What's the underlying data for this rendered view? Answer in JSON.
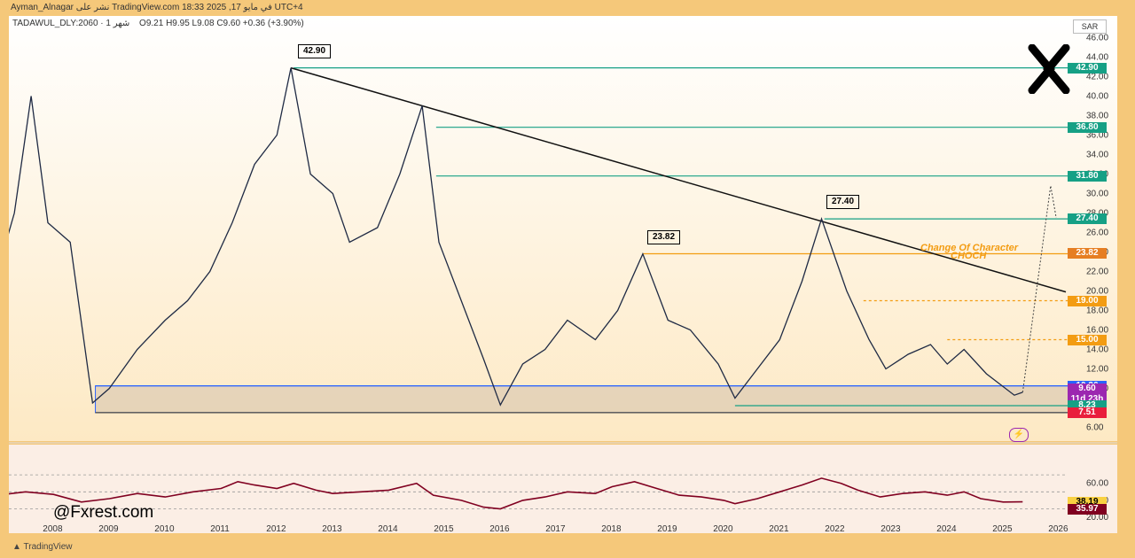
{
  "header": {
    "publisher": "Ayman_Alnagar نشر على TradingView.com في مايو 17, 2025 18:33 UTC+4",
    "symbol": "TADAWUL_DLY:2060 · 1 شهر",
    "ohlc": "O9.21  H9.95  L9.08  C9.60  +0.36 (+3.90%)",
    "currency": "SAR",
    "footer": "TradingView",
    "watermark": "@Fxrest.com"
  },
  "price_labels": [
    {
      "text": "42.90",
      "color": "#16a085"
    },
    {
      "text": "36.80",
      "color": "#16a085"
    },
    {
      "text": "31.80",
      "color": "#16a085"
    },
    {
      "text": "27.40",
      "color": "#16a085"
    },
    {
      "text": "23.82",
      "color": "#e67e22"
    },
    {
      "text": "19.00",
      "color": "#f39c12"
    },
    {
      "text": "15.00",
      "color": "#f39c12"
    },
    {
      "text": "10.26",
      "color": "#2962ff"
    },
    {
      "text": "9.60",
      "color": "#9c27b0"
    },
    {
      "text": "11d 23h",
      "color": "#9c27b0"
    },
    {
      "text": "8.23",
      "color": "#16a085"
    },
    {
      "text": "7.51",
      "color": "#e91e3c"
    }
  ],
  "peak_tags": [
    {
      "text": "42.90",
      "color": "#f23645"
    },
    {
      "text": "27.40",
      "color": "#00bcd4"
    },
    {
      "text": "23.82",
      "color": "#ff9800"
    }
  ],
  "annotations": {
    "choch_line1": "Change Of Character",
    "choch_line2": "CHOCH"
  },
  "rsi_labels": [
    {
      "text": "38.19",
      "color": "#f9d142"
    },
    {
      "text": "35.97",
      "color": "#800020"
    }
  ],
  "chart_data": [
    {
      "type": "line",
      "title": "",
      "ylim": [
        6,
        46
      ],
      "y_ticks": [
        "46.00",
        "44.00",
        "42.00",
        "40.00",
        "38.00",
        "36.00",
        "34.00",
        "32.00",
        "30.00",
        "28.00",
        "26.00",
        "24.00",
        "22.00",
        "20.00",
        "18.00",
        "16.00",
        "14.00",
        "12.00",
        "10.00",
        "8.00",
        "6.00"
      ],
      "x_ticks": [
        "2008",
        "2009",
        "2010",
        "2011",
        "2012",
        "2013",
        "2014",
        "2015",
        "2016",
        "2017",
        "2018",
        "2019",
        "2020",
        "2021",
        "2022",
        "2023",
        "2024",
        "2025",
        "2026"
      ],
      "series": [
        {
          "values": [
            {
              "x": 2007.0,
              "y": 22
            },
            {
              "x": 2007.3,
              "y": 28
            },
            {
              "x": 2007.6,
              "y": 40
            },
            {
              "x": 2007.9,
              "y": 27
            },
            {
              "x": 2008.3,
              "y": 25
            },
            {
              "x": 2008.7,
              "y": 8.5
            },
            {
              "x": 2009.0,
              "y": 10
            },
            {
              "x": 2009.5,
              "y": 14
            },
            {
              "x": 2010.0,
              "y": 17
            },
            {
              "x": 2010.4,
              "y": 19
            },
            {
              "x": 2010.8,
              "y": 22
            },
            {
              "x": 2011.2,
              "y": 27
            },
            {
              "x": 2011.6,
              "y": 33
            },
            {
              "x": 2012.0,
              "y": 36
            },
            {
              "x": 2012.25,
              "y": 42.9
            },
            {
              "x": 2012.6,
              "y": 32
            },
            {
              "x": 2013.0,
              "y": 30
            },
            {
              "x": 2013.3,
              "y": 25
            },
            {
              "x": 2013.8,
              "y": 26.5
            },
            {
              "x": 2014.2,
              "y": 32
            },
            {
              "x": 2014.6,
              "y": 39
            },
            {
              "x": 2014.9,
              "y": 25
            },
            {
              "x": 2015.3,
              "y": 19
            },
            {
              "x": 2015.7,
              "y": 13
            },
            {
              "x": 2016.0,
              "y": 8.3
            },
            {
              "x": 2016.4,
              "y": 12.5
            },
            {
              "x": 2016.8,
              "y": 14
            },
            {
              "x": 2017.2,
              "y": 17
            },
            {
              "x": 2017.7,
              "y": 15
            },
            {
              "x": 2018.1,
              "y": 18
            },
            {
              "x": 2018.55,
              "y": 23.8
            },
            {
              "x": 2019.0,
              "y": 17
            },
            {
              "x": 2019.4,
              "y": 16
            },
            {
              "x": 2019.9,
              "y": 12.5
            },
            {
              "x": 2020.2,
              "y": 9
            },
            {
              "x": 2020.6,
              "y": 12
            },
            {
              "x": 2021.0,
              "y": 15
            },
            {
              "x": 2021.4,
              "y": 21
            },
            {
              "x": 2021.75,
              "y": 27.4
            },
            {
              "x": 2022.2,
              "y": 20
            },
            {
              "x": 2022.6,
              "y": 15
            },
            {
              "x": 2022.9,
              "y": 12
            },
            {
              "x": 2023.3,
              "y": 13.5
            },
            {
              "x": 2023.7,
              "y": 14.5
            },
            {
              "x": 2024.0,
              "y": 12.5
            },
            {
              "x": 2024.3,
              "y": 14
            },
            {
              "x": 2024.7,
              "y": 11.5
            },
            {
              "x": 2025.2,
              "y": 9.3
            },
            {
              "x": 2025.35,
              "y": 9.6
            }
          ]
        }
      ],
      "levels": [
        42.9,
        36.8,
        31.8,
        27.4,
        23.82,
        19.0,
        15.0,
        10.26,
        8.23,
        7.51
      ],
      "demand_zone": [
        7.51,
        10.26
      ]
    },
    {
      "type": "line",
      "title": "",
      "ylim": [
        20,
        80
      ],
      "y_ticks": [
        "60.00",
        "40.00",
        "20.00"
      ],
      "series": [
        {
          "values": [
            {
              "x": 2007.0,
              "y": 46
            },
            {
              "x": 2007.5,
              "y": 50
            },
            {
              "x": 2008.0,
              "y": 47
            },
            {
              "x": 2008.5,
              "y": 38
            },
            {
              "x": 2009.0,
              "y": 42
            },
            {
              "x": 2009.5,
              "y": 48
            },
            {
              "x": 2010.0,
              "y": 44
            },
            {
              "x": 2010.5,
              "y": 50
            },
            {
              "x": 2011.0,
              "y": 54
            },
            {
              "x": 2011.3,
              "y": 62
            },
            {
              "x": 2011.6,
              "y": 58
            },
            {
              "x": 2012.0,
              "y": 54
            },
            {
              "x": 2012.3,
              "y": 60
            },
            {
              "x": 2012.7,
              "y": 52
            },
            {
              "x": 2013.0,
              "y": 48
            },
            {
              "x": 2013.5,
              "y": 50
            },
            {
              "x": 2014.0,
              "y": 52
            },
            {
              "x": 2014.5,
              "y": 60
            },
            {
              "x": 2014.8,
              "y": 46
            },
            {
              "x": 2015.3,
              "y": 40
            },
            {
              "x": 2015.7,
              "y": 32
            },
            {
              "x": 2016.0,
              "y": 30
            },
            {
              "x": 2016.4,
              "y": 40
            },
            {
              "x": 2016.8,
              "y": 44
            },
            {
              "x": 2017.2,
              "y": 50
            },
            {
              "x": 2017.7,
              "y": 48
            },
            {
              "x": 2018.0,
              "y": 56
            },
            {
              "x": 2018.4,
              "y": 62
            },
            {
              "x": 2018.8,
              "y": 54
            },
            {
              "x": 2019.2,
              "y": 46
            },
            {
              "x": 2019.6,
              "y": 44
            },
            {
              "x": 2020.0,
              "y": 40
            },
            {
              "x": 2020.2,
              "y": 36
            },
            {
              "x": 2020.6,
              "y": 42
            },
            {
              "x": 2021.0,
              "y": 50
            },
            {
              "x": 2021.4,
              "y": 58
            },
            {
              "x": 2021.75,
              "y": 66
            },
            {
              "x": 2022.1,
              "y": 60
            },
            {
              "x": 2022.4,
              "y": 52
            },
            {
              "x": 2022.8,
              "y": 44
            },
            {
              "x": 2023.2,
              "y": 48
            },
            {
              "x": 2023.6,
              "y": 50
            },
            {
              "x": 2024.0,
              "y": 46
            },
            {
              "x": 2024.3,
              "y": 50
            },
            {
              "x": 2024.6,
              "y": 42
            },
            {
              "x": 2025.0,
              "y": 38
            },
            {
              "x": 2025.35,
              "y": 38.2
            }
          ]
        }
      ],
      "levels": [
        38.19,
        35.97
      ]
    }
  ]
}
